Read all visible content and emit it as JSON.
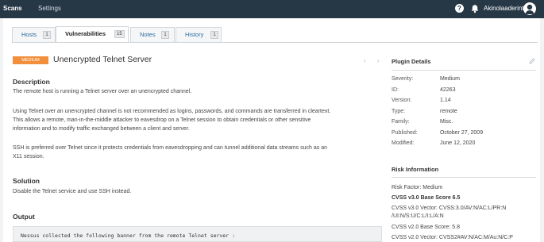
{
  "topbar": {
    "scans": "Scans",
    "settings": "Settings",
    "help_glyph": "?",
    "username": "Akinolaaderinto"
  },
  "tabs": [
    {
      "label": "Hosts",
      "count": "1"
    },
    {
      "label": "Vulnerabilities",
      "count": "15"
    },
    {
      "label": "Notes",
      "count": "1"
    },
    {
      "label": "History",
      "count": "1"
    }
  ],
  "vuln": {
    "severity": "MEDIUM",
    "title": "Unencrypted Telnet Server",
    "pager": "‹ ›"
  },
  "description": {
    "heading": "Description",
    "p1": "The remote host is running a Telnet server over an unencrypted channel.",
    "p2a": "Using Telnet over an unencrypted channel is not recommended as logins, passwords, and commands are transferred in cleartext.",
    "p2b": "This allows a remote, man-in-the-middle attacker to eavesdrop on a Telnet session to obtain credentials or other sensitive",
    "p2c": "information and to modify traffic exchanged between a client and server.",
    "p3a": "SSH is preferred over Telnet since it protects credentials from eavesdropping and can tunnel additional data streams such as an",
    "p3b": "X11 session."
  },
  "solution": {
    "heading": "Solution",
    "text": "Disable the Telnet service and use SSH instead."
  },
  "output": {
    "heading": "Output",
    "text": "Nessus collected the following banner from the remote Telnet server :"
  },
  "plugin_details": {
    "heading": "Plugin Details",
    "rows": [
      {
        "label": "Severity:",
        "value": "Medium"
      },
      {
        "label": "ID:",
        "value": "42263"
      },
      {
        "label": "Version:",
        "value": "1.14"
      },
      {
        "label": "Type:",
        "value": "remote"
      },
      {
        "label": "Family:",
        "value": "Misc."
      },
      {
        "label": "Published:",
        "value": "October 27, 2009"
      },
      {
        "label": "Modified:",
        "value": "June 12, 2020"
      }
    ]
  },
  "risk_info": {
    "heading": "Risk Information",
    "risk_factor": "Risk Factor: Medium",
    "cvss3_base": "CVSS v3.0 Base Score 6.5",
    "cvss3_vector_a": "CVSS v3.0 Vector: CVSS:3.0/AV:N/AC:L/PR:N",
    "cvss3_vector_b": "/UI:N/S:U/C:L/I:L/A:N",
    "cvss2_base": "CVSS v2.0 Base Score: 5.8",
    "cvss2_vector": "CVSS v2.0 Vector: CVSS2#AV:N/AC:M/Au:N/C:P"
  },
  "colors": {
    "topbar": "#263746",
    "severity_medium": "#f28f3d",
    "link": "#2d6ea0"
  },
  "icons": [
    "help-icon",
    "bell-icon",
    "avatar-icon",
    "edit-icon",
    "chevron-left-icon",
    "chevron-right-icon"
  ]
}
